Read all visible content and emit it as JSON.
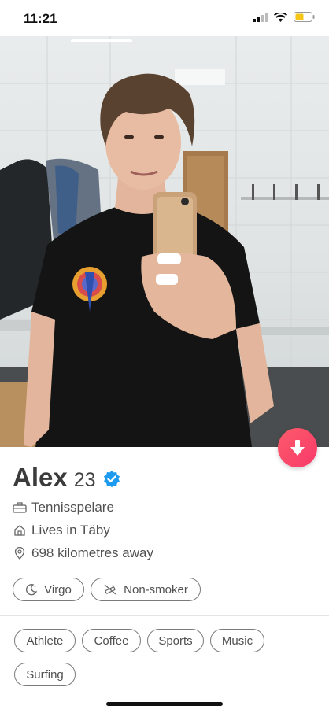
{
  "status_bar": {
    "time": "11:21"
  },
  "profile": {
    "name": "Alex",
    "age": "23",
    "job": "Tennisspelare",
    "lives": "Lives in Täby",
    "distance": "698 kilometres away"
  },
  "basics": [
    {
      "label": "Virgo",
      "icon": "moon-icon"
    },
    {
      "label": "Non-smoker",
      "icon": "no-smoking-icon"
    }
  ],
  "interests": [
    "Athlete",
    "Coffee",
    "Sports",
    "Music",
    "Surfing"
  ],
  "colors": {
    "accent": "#fd5b6a",
    "verified": "#1d9bf0"
  }
}
